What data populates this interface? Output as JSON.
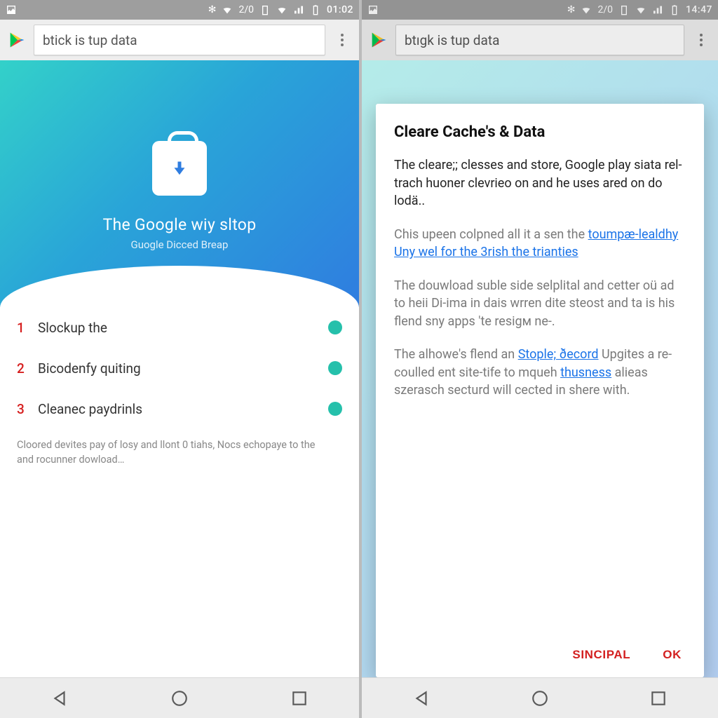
{
  "left": {
    "status": {
      "net": "2/0",
      "time": "01:02"
    },
    "search": {
      "value": "btick is tup data"
    },
    "hero": {
      "title": "The Google wiy sltop",
      "subtitle": "Guogle Dicced Breap"
    },
    "items": [
      {
        "num": "1",
        "label": "Slockup the"
      },
      {
        "num": "2",
        "label": "Bicodenfy quiting"
      },
      {
        "num": "3",
        "label": "Cleanec paydrinls"
      }
    ],
    "footnote": "Cloored devites pay of losy and llont 0 tiahs, Nocs echopaye to the and rocunner dowload…"
  },
  "right": {
    "status": {
      "net": "2/0",
      "time": "14:47"
    },
    "search": {
      "value": "btıgk is tup data"
    },
    "dialog": {
      "title": "Cleare Cache's & Data",
      "p1": "The cleare;; clesses and store, Google play siata rel-trach huoner clevrieo on and he uses ared on do lodä..",
      "p2_a": "Chis upeen colpned all it a sen the ",
      "p2_link": "toumpæ-lealdhy Uny wel for the 3rish the trianties",
      "p3": "The douwload suble side selplital and cetter oü ad to heii Di-ima in dais wrren dite steost and ta is his flend sny apps 'te resigм ne-.",
      "p4_a": "The alhowe's flend an ",
      "p4_link1": "Stople; ðecord",
      "p4_b": " Upgites a re-coulled ent site-tife to mqueh ",
      "p4_link2": "thusness",
      "p4_c": " alieas szerasch secturd will cected in shere with.",
      "btn1": "SINCIPAL",
      "btn2": "OK"
    }
  }
}
